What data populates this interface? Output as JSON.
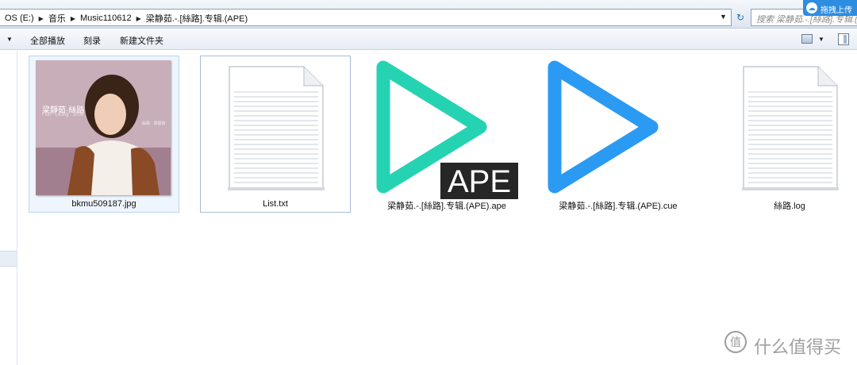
{
  "address": {
    "crumbs": [
      "OS (E:)",
      "音乐",
      "Music110612",
      "梁静茹.-.[絲路].专辑.(APE)"
    ],
    "search_placeholder": "搜索 梁静茹.-.[絲路].专辑.(A",
    "upload_label": "拖拽上传"
  },
  "toolbar": {
    "play_all_label": "全部播放",
    "burn_label": "刻录",
    "new_folder_label": "新建文件夹"
  },
  "files": [
    {
      "name": "bkmu509187.jpg",
      "type": "image",
      "cover_title": "梁靜茹·絲路",
      "cover_sub": "Fish · Leong · 2005",
      "cover_right": "絲路 · 梁靜茹"
    },
    {
      "name": "List.txt",
      "type": "text"
    },
    {
      "name": "梁静茹.-.[絲路].专辑.(APE).ape",
      "type": "ape",
      "badge": "APE",
      "color": "#25d3b3"
    },
    {
      "name": "梁静茹.-.[絲路].专辑.(APE).cue",
      "type": "cue",
      "color": "#2b9af3"
    },
    {
      "name": "絲路.log",
      "type": "text"
    }
  ],
  "watermark": {
    "text": "什么值得买"
  }
}
